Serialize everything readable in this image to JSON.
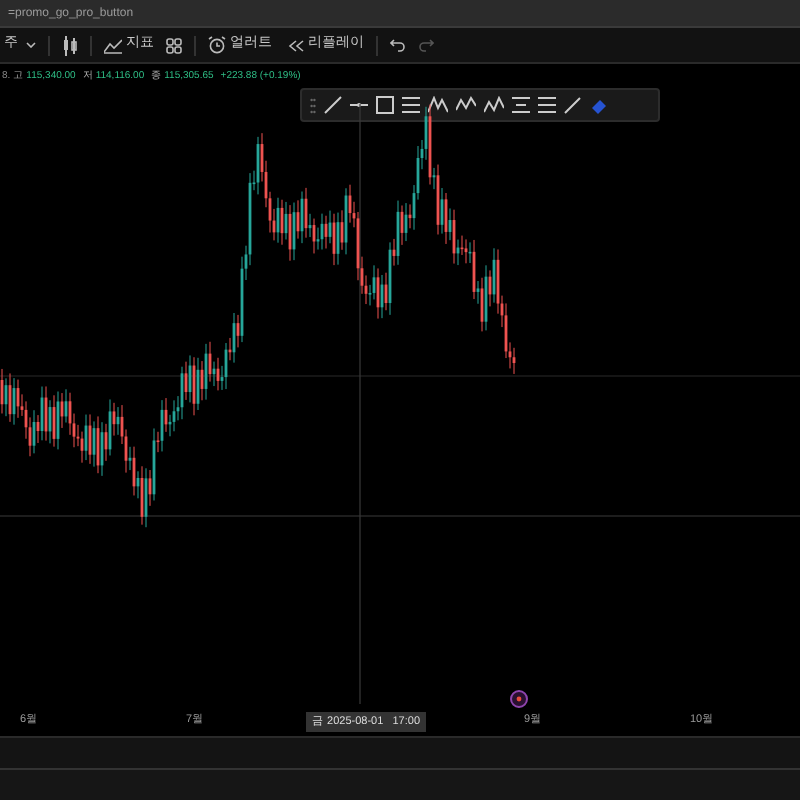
{
  "address_bar": {
    "text": "=promo_go_pro_button"
  },
  "toolbar": {
    "interval": "주",
    "indicators": "지표",
    "alerts": "얼러트",
    "replay": "리플레이"
  },
  "ohlc": {
    "prefix": "8.",
    "high_label": "고",
    "high": "115,340.00",
    "low_label": "저",
    "low": "114,116.00",
    "close_label": "종",
    "close": "115,305.65",
    "change": "+223.88 (+0.19%)"
  },
  "time_axis": {
    "labels": [
      "6월",
      "7월",
      "9월",
      "10월"
    ],
    "crosshair_label": "금 2025-08-01   17:00"
  }
}
